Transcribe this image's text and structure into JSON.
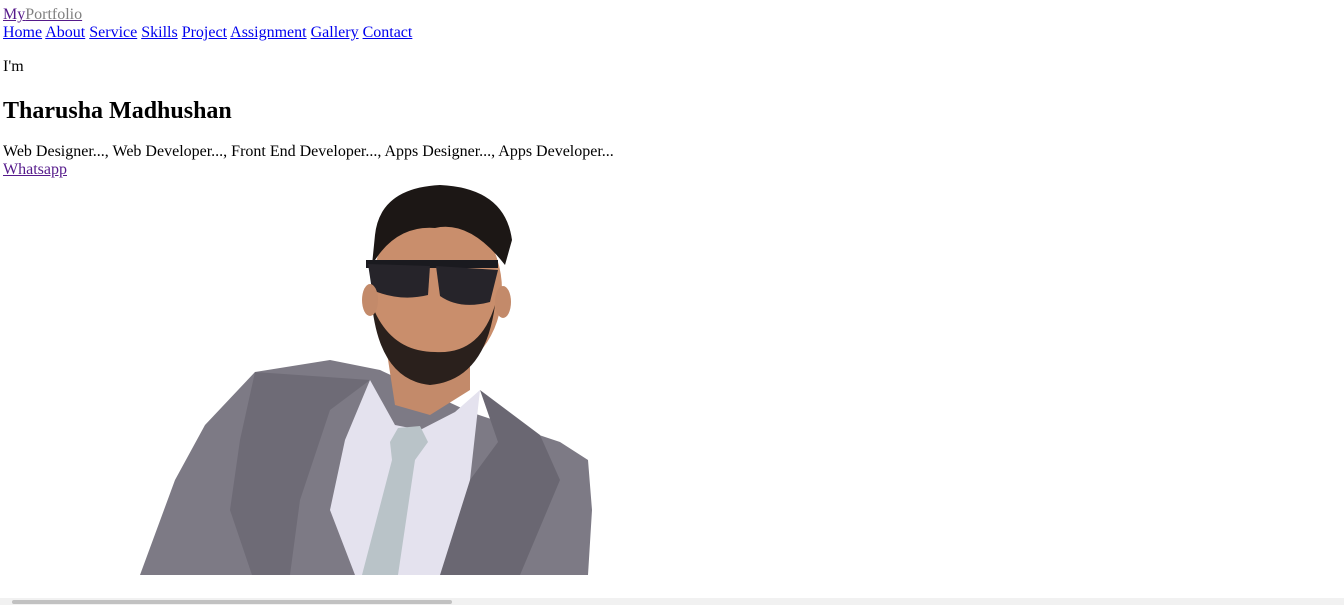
{
  "logo": {
    "prefix": "My",
    "suffix": "Portfolio"
  },
  "nav": {
    "items": [
      "Home",
      "About",
      "Service",
      "Skills",
      "Project",
      "Assignment",
      "Gallery",
      "Contact"
    ]
  },
  "hero": {
    "intro": "I'm",
    "name": "Tharusha Madhushan",
    "roles": "Web Designer..., Web Developer..., Front End Developer..., Apps Designer..., Apps Developer...",
    "whatsapp_label": "Whatsapp",
    "photo_icon": "portrait-photo"
  }
}
